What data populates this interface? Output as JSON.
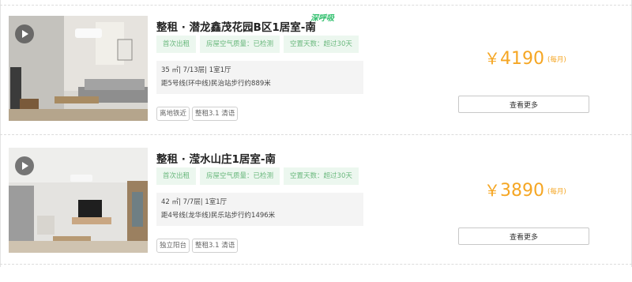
{
  "listings": [
    {
      "title": "整租 · 潜龙鑫茂花园B区1居室-南",
      "badge": "深呼吸",
      "tags": [
        "首次出租",
        "房屋空气质量：已检测",
        "空置天数：超过30天"
      ],
      "detail": "35 ㎡| 7/13层| 1室1厅",
      "transit": "距5号线(环中线)民治站步行约889米",
      "features": [
        "离地铁近",
        "整租3.1 清语"
      ],
      "price": "4190",
      "currency": "￥",
      "period": "(每月)",
      "more_label": "查看更多",
      "play_icon": "play-icon"
    },
    {
      "title": "整租 · 滢水山庄1居室-南",
      "badge": "",
      "tags": [
        "首次出租",
        "房屋空气质量：已检测",
        "空置天数：超过30天"
      ],
      "detail": "42 ㎡| 7/7层| 1室1厅",
      "transit": "距4号线(龙华线)民乐站步行约1496米",
      "features": [
        "独立阳台",
        "整租3.1 清语"
      ],
      "price": "3890",
      "currency": "￥",
      "period": "(每月)",
      "more_label": "查看更多",
      "play_icon": "play-icon"
    }
  ],
  "colors": {
    "price": "#f5a623",
    "tag_bg": "#ecf7ef",
    "tag_text": "#6ab87d",
    "badge": "#2fbf6c"
  }
}
